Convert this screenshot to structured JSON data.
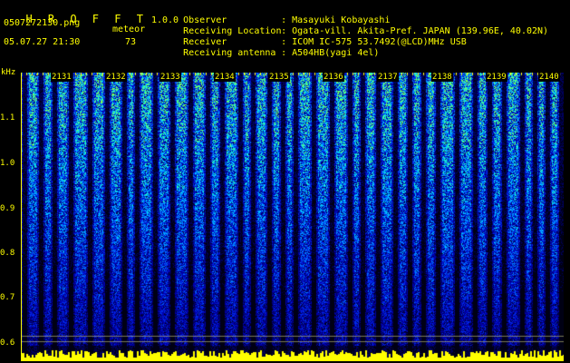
{
  "header": {
    "app_title": "H R O F F T",
    "version": "1.0.0",
    "filename": "0507272130.png",
    "datetime": "05.07.27 21:30",
    "meteor_label": "meteor",
    "meteor_count": "73"
  },
  "info": [
    {
      "label": "Observer",
      "value": "Masayuki Kobayashi"
    },
    {
      "label": "Receiving Location",
      "value": "Ogata-vill. Akita-Pref. JAPAN (139.96E, 40.02N)"
    },
    {
      "label": "Receiver",
      "value": "ICOM IC-575 53.7492(@LCD)MHz USB"
    },
    {
      "label": "Receiving antenna",
      "value": "A504HB(yagi 4el)"
    }
  ],
  "chart_data": {
    "type": "heatmap",
    "ylabel": "kHz",
    "y_ticks": [
      "1.1",
      "1.0",
      "0.9",
      "0.8",
      "0.7",
      "0.6"
    ],
    "ylim": [
      0.6,
      1.15
    ],
    "x_ticks": [
      "2131",
      "2132",
      "2133",
      "2134",
      "2135",
      "2136",
      "2137",
      "2138",
      "2139",
      "2140"
    ],
    "colors": {
      "low": "#000080",
      "mid": "#00a0ff",
      "high": "#40ff80",
      "level": "#ffff00"
    }
  }
}
